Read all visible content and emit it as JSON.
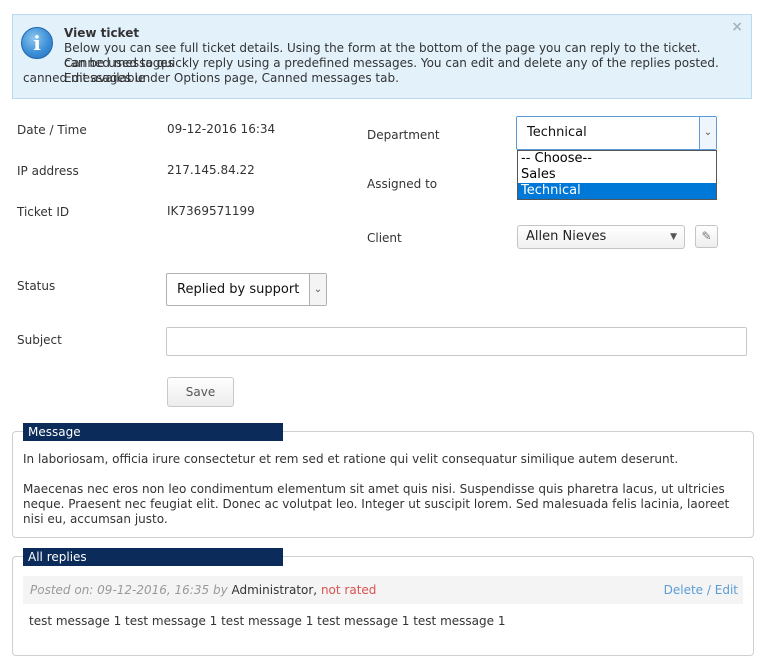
{
  "notice": {
    "title": "View ticket",
    "line1": "Below you can see full ticket details. Using the form at the bottom of the page you can reply to the ticket. Canned messages",
    "line2": "can be used to quickly reply using a predefined messages. You can edit and delete any of the replies posted. Edit available",
    "line3": "canned messages under Options page, Canned messages tab.",
    "close": "×"
  },
  "details": {
    "date_label": "Date / Time",
    "date_value": "09-12-2016 16:34",
    "ip_label": "IP address",
    "ip_value": "217.145.84.22",
    "id_label": "Ticket ID",
    "id_value": "IK7369571199",
    "department_label": "Department",
    "department_value": "Technical",
    "department_options": [
      "-- Choose--",
      "Sales",
      "Technical"
    ],
    "assigned_label": "Assigned to",
    "client_label": "Client",
    "client_value": "Allen Nieves",
    "status_label": "Status",
    "status_value": "Replied by support",
    "subject_label": "Subject",
    "subject_value": "",
    "save_label": "Save"
  },
  "message": {
    "legend": "Message",
    "paragraph1": "In laboriosam, officia irure consectetur et rem sed et ratione qui velit consequatur similique autem deserunt.",
    "paragraph2": "Maecenas nec eros non leo condimentum elementum sit amet quis nisi. Suspendisse quis pharetra lacus, ut ultricies neque. Praesent nec feugiat elit. Donec ac volutpat leo. Integer ut suscipit lorem. Sed malesuada felis lacinia, laoreet nisi eu, accumsan justo."
  },
  "replies": {
    "legend": "All replies",
    "items": [
      {
        "posted_prefix": "Posted on:",
        "date": "09-12-2016, 16:35",
        "by": "by",
        "author": "Administrator,",
        "rating": "not rated",
        "delete": "Delete",
        "separator": "/",
        "edit": "Edit",
        "text": "test message 1 test message 1 test message 1 test message 1 test message 1"
      }
    ]
  },
  "colors": {
    "legend_bg": "#0b2c5a",
    "notice_bg": "#e3f1fb",
    "link": "#5a9dd6",
    "not_rated": "#d9534f",
    "dropdown_selected": "#0078d7"
  }
}
